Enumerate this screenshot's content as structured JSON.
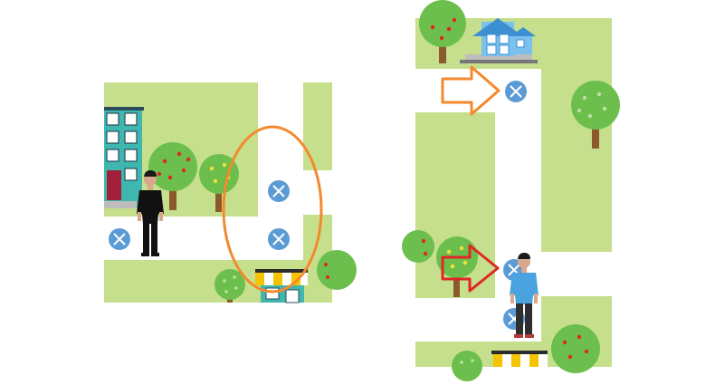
{
  "colors": {
    "grass": "#c6df8d",
    "road": "#ffffff",
    "marker": "#5b9bd5",
    "orange_accent": "#f4892e",
    "red_accent": "#e02626",
    "tree_leaf": "#6cbf4d",
    "tree_trunk": "#8b5a2b",
    "building_teal": "#3fb6ae",
    "house_blue": "#7cc0ee",
    "awning_yellow": "#f5c400"
  },
  "icons": [
    "crossing-marker-icon",
    "person-icon",
    "tree-icon",
    "apartment-building-icon",
    "house-icon",
    "shop-awning-icon",
    "arrow-icon",
    "ellipse-highlight"
  ],
  "left_map": {
    "highlight": "orange-ellipse",
    "marker_count": 3,
    "person_shirt": "black"
  },
  "right_map": {
    "arrows": [
      "orange",
      "red"
    ],
    "marker_count": 3,
    "person_shirt": "blue"
  }
}
